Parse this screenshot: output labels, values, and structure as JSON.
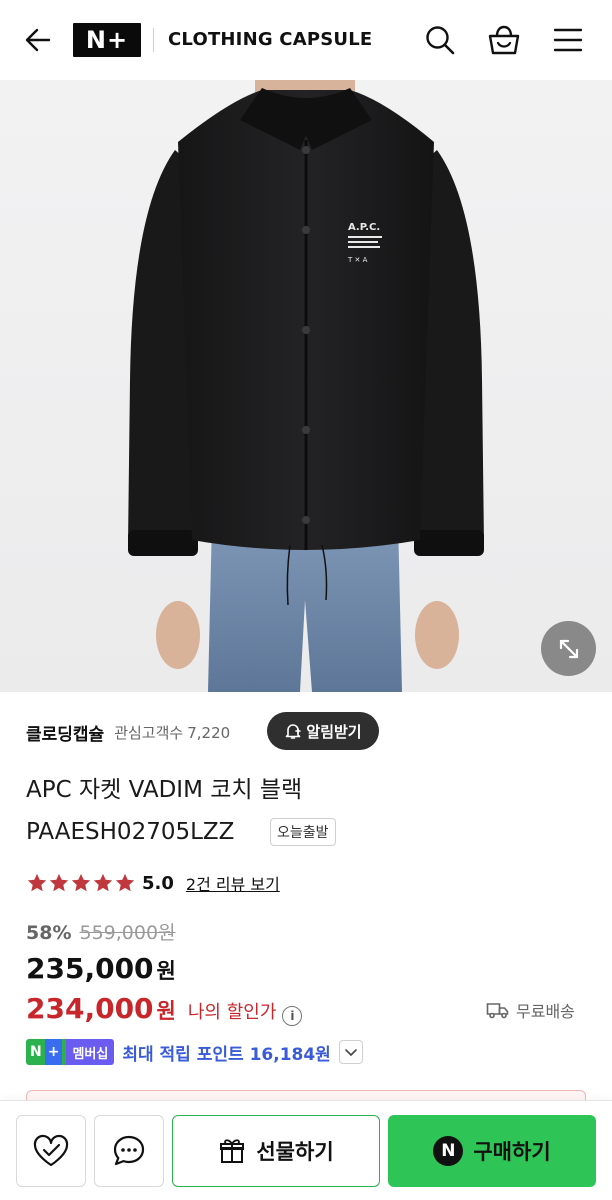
{
  "header": {
    "logo_text": "N+",
    "store_title": "CLOTHING CAPSULE",
    "icons": [
      "back-arrow-icon",
      "search-icon",
      "shopping-bag-icon",
      "menu-icon"
    ]
  },
  "product": {
    "image_alt_icon": "zoom-expand-icon",
    "brand": {
      "name": "클로딩캡슐",
      "followers_label": "관심고객수",
      "followers_count": "7,220",
      "alert_button": "알림받기"
    },
    "title_line1": "APC 자켓 VADIM 코치 블랙",
    "title_line2": "PAAESH02705LZZ",
    "today_badge": "오늘출발",
    "rating": {
      "stars": 5,
      "score": "5.0",
      "reviews_link": "2건 리뷰 보기",
      "star_color": "#c0383d"
    },
    "price": {
      "discount_rate": "58%",
      "original_price": "559,000원",
      "sale_price": "235,000",
      "sale_unit": "원",
      "my_price": "234,000",
      "my_price_unit": "원",
      "my_discount_label": "나의 할인가",
      "delivery": "무료배송",
      "accent_color": "#c8262b"
    },
    "points": {
      "badge_logo": "N",
      "badge_plus": "+",
      "badge_member": "멤버십",
      "text": "최대 적립 포인트 16,184원"
    }
  },
  "bottom_bar": {
    "zzim_icon": "heart-check-icon",
    "talk_icon": "chat-bubble-icon",
    "gift_label": "선물하기",
    "buy_n": "N",
    "buy_label": "구매하기",
    "buy_color": "#2fc456"
  }
}
